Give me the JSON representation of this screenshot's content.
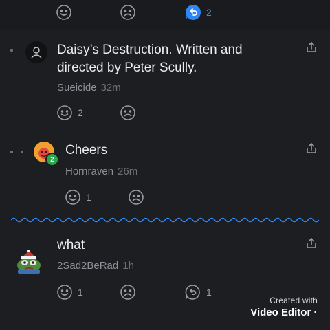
{
  "top_row": {
    "reply_count": "2"
  },
  "comments": [
    {
      "text": "Daisy’s Destruction. Written and directed by Peter Scully.",
      "text_line1": "Daisy’s Destruction. Written and",
      "text_line2": "directed by Peter Scully.",
      "author": "Sueicide",
      "time": "32m",
      "like_count": "2"
    },
    {
      "text": "Cheers",
      "author": "Hornraven",
      "time": "26m",
      "like_count": "1",
      "badge": "2"
    },
    {
      "text": "what",
      "author": "2Sad2BeRad",
      "time": "1h",
      "like_count": "1",
      "reply_count": "1"
    }
  ],
  "watermark": {
    "line1": "Created with",
    "line2": "Video Editor ·"
  },
  "colors": {
    "background": "#1d1e21",
    "accent": "#3b82f6",
    "divider": "#2f86f5",
    "badge": "#2aa84a"
  }
}
